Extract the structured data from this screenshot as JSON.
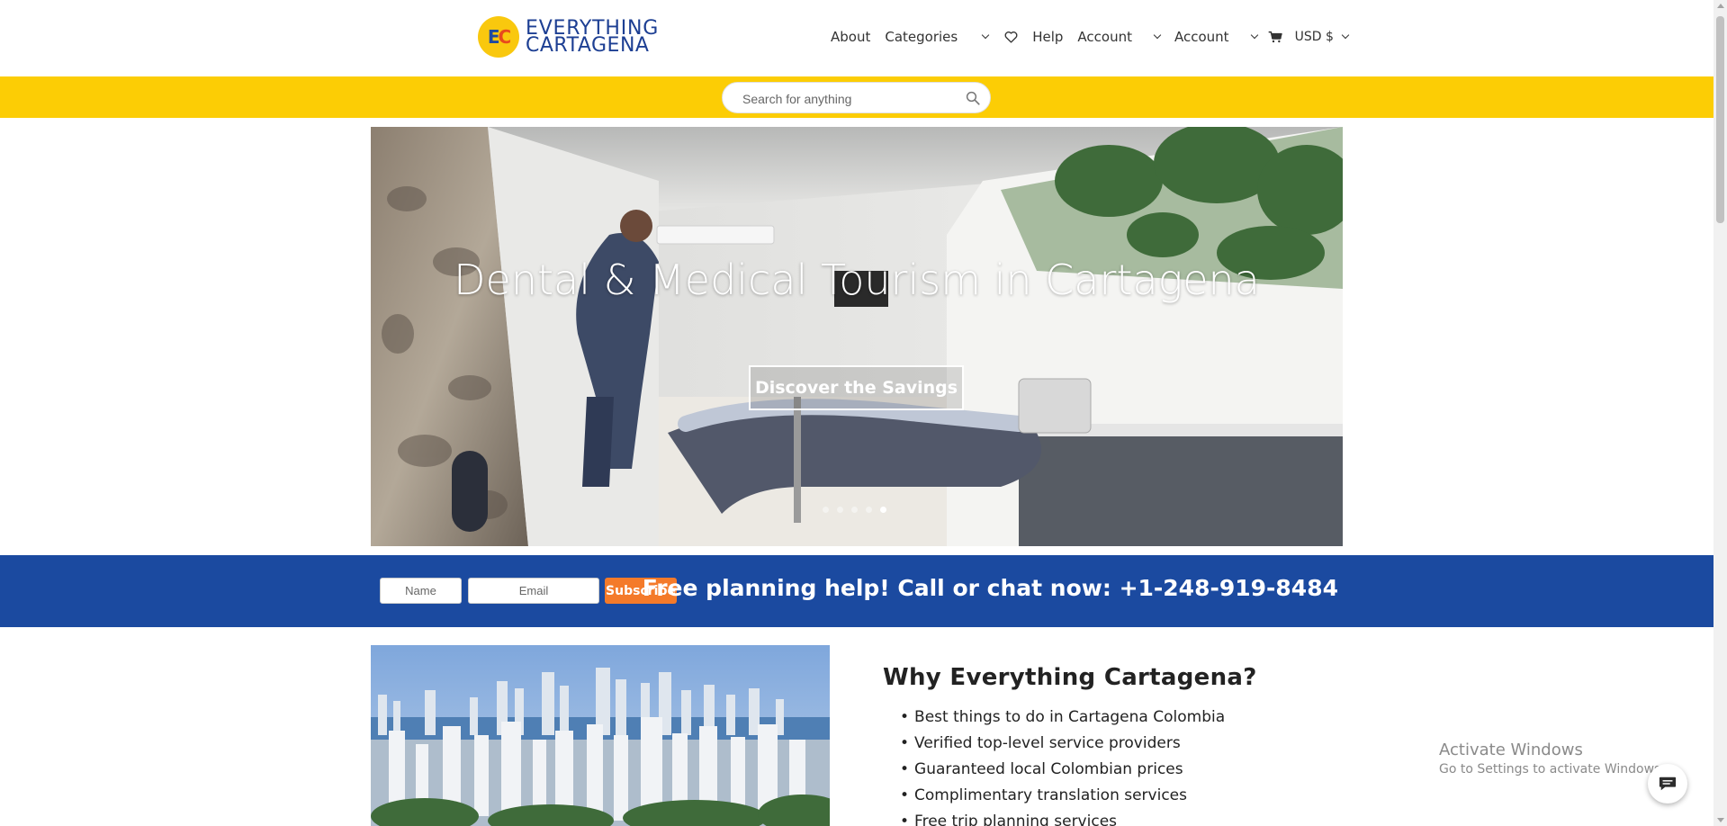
{
  "brand": {
    "logo_letters_1": "E",
    "logo_letters_2": "C",
    "name_line1": "EVERYTHING",
    "name_line2": "CARTAGENA"
  },
  "nav": {
    "about": "About",
    "categories": "Categories",
    "help": "Help",
    "account_1": "Account",
    "account_2": "Account",
    "currency": "USD $"
  },
  "search": {
    "placeholder": "Search for anything"
  },
  "hero": {
    "title": "Dental & Medical Tourism in Cartagena",
    "button": "Discover the Savings",
    "slides_count": 5,
    "active_slide": 5
  },
  "subscribe": {
    "name_placeholder": "Name",
    "email_placeholder": "Email",
    "button": "Subscribe",
    "help_text": "Free planning help! Call or chat now: +1-248-919-8484"
  },
  "why": {
    "title": "Why Everything Cartagena?",
    "items": [
      "Best things to do in Cartagena Colombia",
      "Verified top-level service providers",
      "Guaranteed local Colombian prices",
      "Complimentary translation services",
      "Free trip planning services"
    ]
  },
  "watermark": {
    "line1": "Activate Windows",
    "line2": "Go to Settings to activate Windows."
  },
  "colors": {
    "accent_yellow": "#fccd05",
    "brand_blue": "#1b4aa0",
    "subscribe_orange": "#f47a2a"
  },
  "icons": [
    "search-icon",
    "heart-icon",
    "cart-icon",
    "chevron-down-icon",
    "chat-icon"
  ]
}
